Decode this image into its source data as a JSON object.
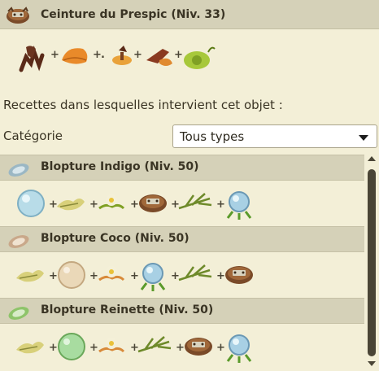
{
  "item": {
    "title": "Ceinture du Prespic (Niv. 33)",
    "ingredients": [
      "claw-icon",
      "orange-leaf-icon",
      "mushroom-icon",
      "brown-tail-icon",
      "green-snail-icon"
    ]
  },
  "recipes_text": "Recettes dans lesquelles intervient cet objet :",
  "category": {
    "label": "Catégorie",
    "selected": "Tous types"
  },
  "recipes": [
    {
      "title": "Blopture Indigo (Niv. 50)",
      "icon": "blue-disc-icon",
      "ingredients": [
        "blue-orb-icon",
        "yellow-flower-icon",
        "white-flower-icon",
        "prespic-belt-icon",
        "grass-sprig-icon",
        "blue-gem-icon"
      ]
    },
    {
      "title": "Blopture Coco (Niv. 50)",
      "icon": "tan-disc-icon",
      "ingredients": [
        "yellow-flower-icon",
        "beige-orb-icon",
        "white-flower-icon",
        "blue-gem-icon",
        "grass-sprig-icon",
        "prespic-belt-icon"
      ]
    },
    {
      "title": "Blopture Reinette (Niv. 50)",
      "icon": "green-disc-icon",
      "ingredients": [
        "yellow-flower-icon",
        "green-orb-icon",
        "white-flower-icon",
        "grass-sprig-icon",
        "prespic-belt-icon",
        "blue-gem-icon"
      ]
    }
  ]
}
